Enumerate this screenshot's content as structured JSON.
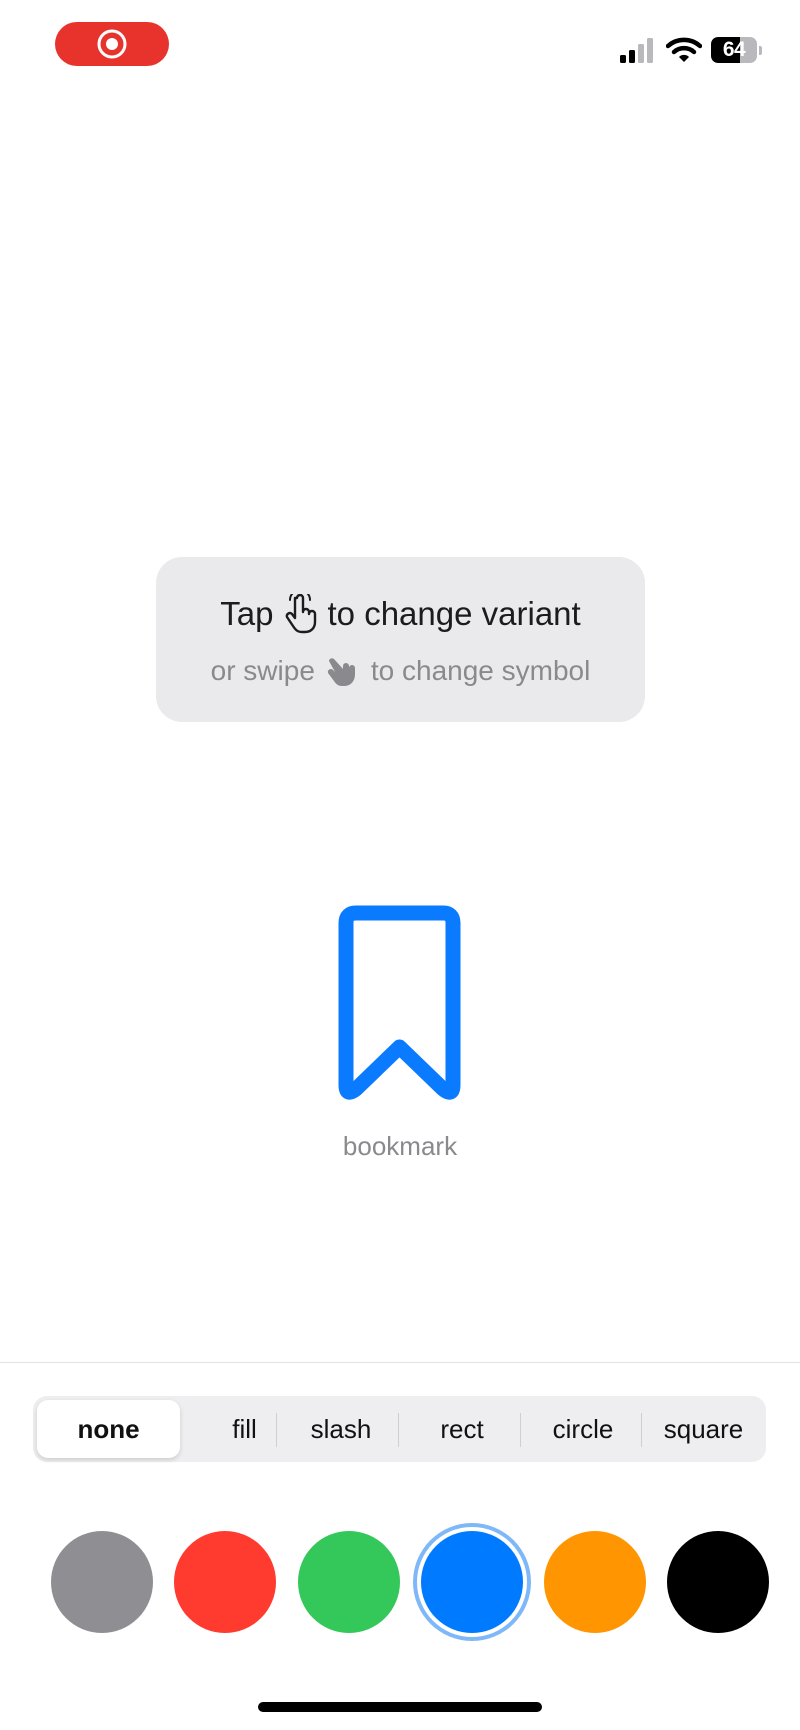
{
  "status_bar": {
    "recording_icon": "record-icon",
    "signal_icon": "cellular-signal-icon",
    "wifi_icon": "wifi-icon",
    "battery_level": "64",
    "battery_fraction": 0.64,
    "recording_color": "#e8332c"
  },
  "hint": {
    "line1_prefix": "Tap",
    "line1_suffix": "to change variant",
    "line2_prefix": "or swipe",
    "line2_suffix": "to change symbol",
    "tap_icon": "hand-tap-icon",
    "swipe_icon": "hand-swipe-icon"
  },
  "symbol": {
    "name": "bookmark",
    "icon": "bookmark-icon",
    "color": "#0a7aff"
  },
  "variants": {
    "items": [
      "none",
      "fill",
      "slash",
      "rect",
      "circle",
      "square"
    ],
    "selected": "none"
  },
  "colors": {
    "swatches": [
      {
        "name": "gray",
        "hex": "#8e8e93"
      },
      {
        "name": "red",
        "hex": "#ff3b30"
      },
      {
        "name": "green",
        "hex": "#34c759"
      },
      {
        "name": "blue",
        "hex": "#007aff"
      },
      {
        "name": "orange",
        "hex": "#ff9500"
      },
      {
        "name": "black",
        "hex": "#000000"
      }
    ],
    "selected": "blue"
  }
}
